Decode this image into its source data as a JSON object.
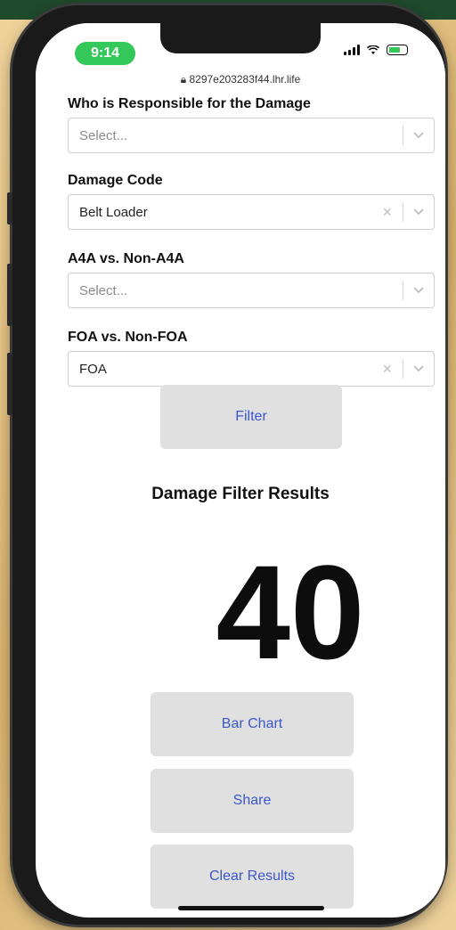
{
  "status_bar": {
    "time": "9:14",
    "url": "8297e203283f44.lhr.life"
  },
  "form": {
    "responsible": {
      "label": "Who is Responsible for the Damage",
      "value": "Select..."
    },
    "damage_code": {
      "label": "Damage Code",
      "value": "Belt Loader"
    },
    "a4a": {
      "label": "A4A vs. Non-A4A",
      "value": "Select..."
    },
    "foa": {
      "label": "FOA vs. Non-FOA",
      "value": "FOA"
    },
    "filter_label": "Filter"
  },
  "results": {
    "title": "Damage Filter Results",
    "count": "40"
  },
  "actions": {
    "bar_chart_label": "Bar Chart",
    "share_label": "Share",
    "clear_label": "Clear Results"
  },
  "colors": {
    "accent_text": "#3b57c9",
    "button_bg": "#e0e0e0",
    "time_pill": "#34c759"
  }
}
